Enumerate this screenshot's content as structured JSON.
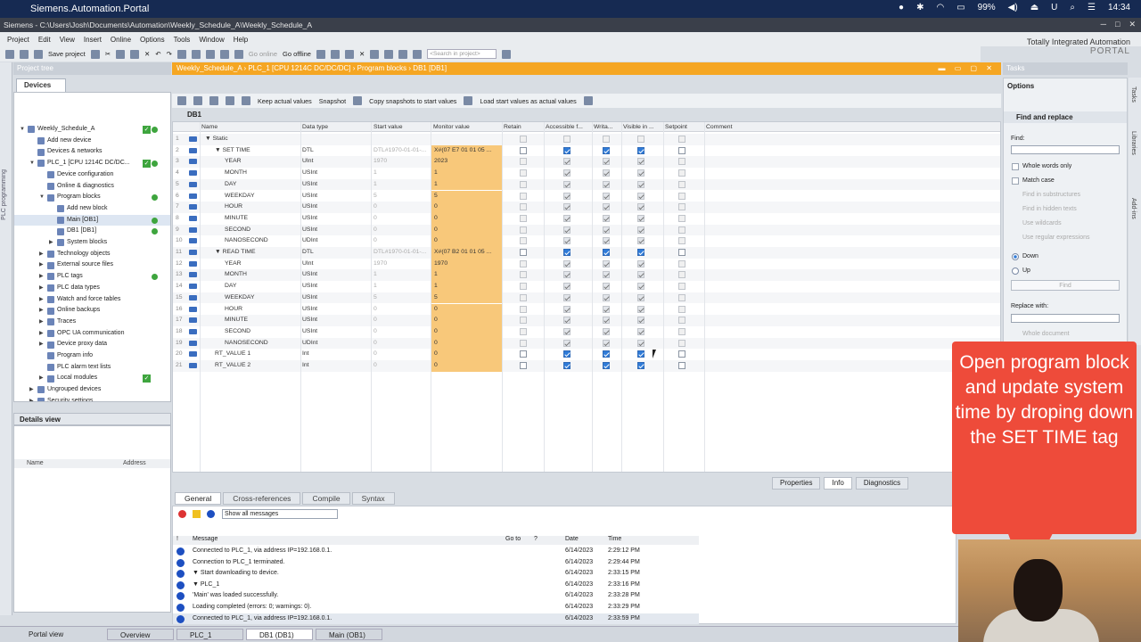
{
  "mac": {
    "app": "Siemens.Automation.Portal",
    "battery": "99%",
    "time": "14:34"
  },
  "window": {
    "title": "Siemens  -  C:\\Users\\Josh\\Documents\\Automation\\Weekly_Schedule_A\\Weekly_Schedule_A"
  },
  "menu": [
    "Project",
    "Edit",
    "View",
    "Insert",
    "Online",
    "Options",
    "Tools",
    "Window",
    "Help"
  ],
  "brand": {
    "line1": "Totally Integrated Automation",
    "line2": "PORTAL"
  },
  "toolbar": {
    "save": "Save project",
    "go_online": "Go online",
    "go_offline": "Go offline",
    "search_placeholder": "<Search in project>"
  },
  "left": {
    "vertical_tab": "PLC programming",
    "header": "Project tree",
    "tab": "Devices",
    "tree": [
      {
        "label": "Weekly_Schedule_A",
        "indent": 0,
        "arrow": "▼",
        "chk": true,
        "dot": true
      },
      {
        "label": "Add new device",
        "indent": 1
      },
      {
        "label": "Devices & networks",
        "indent": 1
      },
      {
        "label": "PLC_1 [CPU 1214C DC/DC...",
        "indent": 1,
        "arrow": "▼",
        "chk": true,
        "dot": true
      },
      {
        "label": "Device configuration",
        "indent": 2
      },
      {
        "label": "Online & diagnostics",
        "indent": 2
      },
      {
        "label": "Program blocks",
        "indent": 2,
        "arrow": "▼",
        "dot": true
      },
      {
        "label": "Add new block",
        "indent": 3
      },
      {
        "label": "Main [OB1]",
        "indent": 3,
        "dot": true,
        "sel": true
      },
      {
        "label": "DB1 [DB1]",
        "indent": 3,
        "dot": true
      },
      {
        "label": "System blocks",
        "indent": 3,
        "arrow": "▶"
      },
      {
        "label": "Technology objects",
        "indent": 2,
        "arrow": "▶"
      },
      {
        "label": "External source files",
        "indent": 2,
        "arrow": "▶"
      },
      {
        "label": "PLC tags",
        "indent": 2,
        "arrow": "▶",
        "dot": true
      },
      {
        "label": "PLC data types",
        "indent": 2,
        "arrow": "▶"
      },
      {
        "label": "Watch and force tables",
        "indent": 2,
        "arrow": "▶"
      },
      {
        "label": "Online backups",
        "indent": 2,
        "arrow": "▶"
      },
      {
        "label": "Traces",
        "indent": 2,
        "arrow": "▶"
      },
      {
        "label": "OPC UA communication",
        "indent": 2,
        "arrow": "▶"
      },
      {
        "label": "Device proxy data",
        "indent": 2,
        "arrow": "▶"
      },
      {
        "label": "Program info",
        "indent": 2
      },
      {
        "label": "PLC alarm text lists",
        "indent": 2
      },
      {
        "label": "Local modules",
        "indent": 2,
        "arrow": "▶",
        "chk": true
      },
      {
        "label": "Ungrouped devices",
        "indent": 1,
        "arrow": "▶"
      },
      {
        "label": "Security settings",
        "indent": 1,
        "arrow": "▶"
      }
    ],
    "details_header": "Details view",
    "details_cols": [
      "Name",
      "Address"
    ]
  },
  "editor": {
    "breadcrumb": "Weekly_Schedule_A  ›  PLC_1 [CPU 1214C DC/DC/DC]  ›  Program blocks  ›  DB1 [DB1]",
    "tb_keep": "Keep actual values",
    "tb_snapshot": "Snapshot",
    "tb_copy": "Copy snapshots to start values",
    "tb_load": "Load start values as actual values",
    "db_name": "DB1",
    "columns": [
      "Name",
      "Data type",
      "Start value",
      "Monitor value",
      "Retain",
      "Accessible f...",
      "Writa...",
      "Visible in ...",
      "Setpoint",
      "Comment"
    ],
    "rows": [
      {
        "n": "1",
        "name": "▼ Static",
        "lvl": 0,
        "type": "",
        "start": "",
        "mon": "",
        "cbs": false
      },
      {
        "n": "2",
        "name": "▼ SET TIME",
        "lvl": 1,
        "type": "DTL",
        "start": "DTL#1970-01-01-...",
        "mon": "X#(07 E7 01 01 05 ...",
        "cbs": true
      },
      {
        "n": "3",
        "name": "YEAR",
        "lvl": 2,
        "type": "UInt",
        "start": "1970",
        "mon": "2023",
        "cbs": true,
        "grey": true
      },
      {
        "n": "4",
        "name": "MONTH",
        "lvl": 2,
        "type": "USInt",
        "start": "1",
        "mon": "1",
        "cbs": true,
        "grey": true
      },
      {
        "n": "5",
        "name": "DAY",
        "lvl": 2,
        "type": "USInt",
        "start": "1",
        "mon": "1",
        "cbs": true,
        "grey": true
      },
      {
        "n": "6",
        "name": "WEEKDAY",
        "lvl": 2,
        "type": "USInt",
        "start": "5",
        "mon": "5",
        "cbs": true,
        "grey": true
      },
      {
        "n": "7",
        "name": "HOUR",
        "lvl": 2,
        "type": "USInt",
        "start": "0",
        "mon": "0",
        "cbs": true,
        "grey": true
      },
      {
        "n": "8",
        "name": "MINUTE",
        "lvl": 2,
        "type": "USInt",
        "start": "0",
        "mon": "0",
        "cbs": true,
        "grey": true
      },
      {
        "n": "9",
        "name": "SECOND",
        "lvl": 2,
        "type": "USInt",
        "start": "0",
        "mon": "0",
        "cbs": true,
        "grey": true
      },
      {
        "n": "10",
        "name": "NANOSECOND",
        "lvl": 2,
        "type": "UDInt",
        "start": "0",
        "mon": "0",
        "cbs": true,
        "grey": true
      },
      {
        "n": "11",
        "name": "▼ READ TIME",
        "lvl": 1,
        "type": "DTL",
        "start": "DTL#1970-01-01-...",
        "mon": "X#(07 B2 01 01 05 ...",
        "cbs": true
      },
      {
        "n": "12",
        "name": "YEAR",
        "lvl": 2,
        "type": "UInt",
        "start": "1970",
        "mon": "1970",
        "cbs": true,
        "grey": true
      },
      {
        "n": "13",
        "name": "MONTH",
        "lvl": 2,
        "type": "USInt",
        "start": "1",
        "mon": "1",
        "cbs": true,
        "grey": true
      },
      {
        "n": "14",
        "name": "DAY",
        "lvl": 2,
        "type": "USInt",
        "start": "1",
        "mon": "1",
        "cbs": true,
        "grey": true
      },
      {
        "n": "15",
        "name": "WEEKDAY",
        "lvl": 2,
        "type": "USInt",
        "start": "5",
        "mon": "5",
        "cbs": true,
        "grey": true
      },
      {
        "n": "16",
        "name": "HOUR",
        "lvl": 2,
        "type": "USInt",
        "start": "0",
        "mon": "0",
        "cbs": true,
        "grey": true
      },
      {
        "n": "17",
        "name": "MINUTE",
        "lvl": 2,
        "type": "USInt",
        "start": "0",
        "mon": "0",
        "cbs": true,
        "grey": true
      },
      {
        "n": "18",
        "name": "SECOND",
        "lvl": 2,
        "type": "USInt",
        "start": "0",
        "mon": "0",
        "cbs": true,
        "grey": true
      },
      {
        "n": "19",
        "name": "NANOSECOND",
        "lvl": 2,
        "type": "UDInt",
        "start": "0",
        "mon": "0",
        "cbs": true,
        "grey": true
      },
      {
        "n": "20",
        "name": "RT_VALUE 1",
        "lvl": 1,
        "type": "Int",
        "start": "0",
        "mon": "0",
        "cbs": true
      },
      {
        "n": "21",
        "name": "RT_VALUE 2",
        "lvl": 1,
        "type": "Int",
        "start": "0",
        "mon": "0",
        "cbs": true
      }
    ]
  },
  "right": {
    "header": "Tasks",
    "options": "Options",
    "find_replace": "Find and replace",
    "find_label": "Find:",
    "whole_words": "Whole words only",
    "match_case": "Match case",
    "find_sub": "Find in substructures",
    "find_hidden": "Find in hidden texts",
    "wildcards": "Use wildcards",
    "regex": "Use regular expressions",
    "down": "Down",
    "up": "Up",
    "find_btn": "Find",
    "replace_label": "Replace with:",
    "whole_doc": "Whole document",
    "vtabs": [
      "Tasks",
      "Libraries",
      "Add-ins"
    ]
  },
  "inspector": {
    "tabs": [
      "Properties",
      "Info",
      "Diagnostics"
    ]
  },
  "info": {
    "tabs": [
      "General",
      "Cross-references",
      "Compile",
      "Syntax"
    ],
    "filter": "Show all messages",
    "cols": [
      "!",
      "Message",
      "Go to",
      "?",
      "Date",
      "Time"
    ],
    "messages": [
      {
        "msg": "Connected to PLC_1, via address IP=192.168.0.1.",
        "date": "6/14/2023",
        "time": "2:29:12 PM"
      },
      {
        "msg": "Connection to PLC_1 terminated.",
        "date": "6/14/2023",
        "time": "2:29:44 PM"
      },
      {
        "msg": "▼ Start downloading to device.",
        "date": "6/14/2023",
        "time": "2:33:15 PM"
      },
      {
        "msg": "   ▼ PLC_1",
        "date": "6/14/2023",
        "time": "2:33:16 PM"
      },
      {
        "msg": "         'Main' was loaded successfully.",
        "date": "6/14/2023",
        "time": "2:33:28 PM"
      },
      {
        "msg": "Loading completed (errors: 0; warnings: 0).",
        "date": "6/14/2023",
        "time": "2:33:29 PM"
      },
      {
        "msg": "Connected to PLC_1, via address IP=192.168.0.1.",
        "date": "6/14/2023",
        "time": "2:33:59 PM"
      }
    ]
  },
  "taskbar": {
    "portal": "Portal view",
    "items": [
      "Overview",
      "PLC_1",
      "DB1 (DB1)",
      "Main (OB1)"
    ]
  },
  "overlay": {
    "text": "Open program block and update system time by droping down the SET TIME tag"
  }
}
